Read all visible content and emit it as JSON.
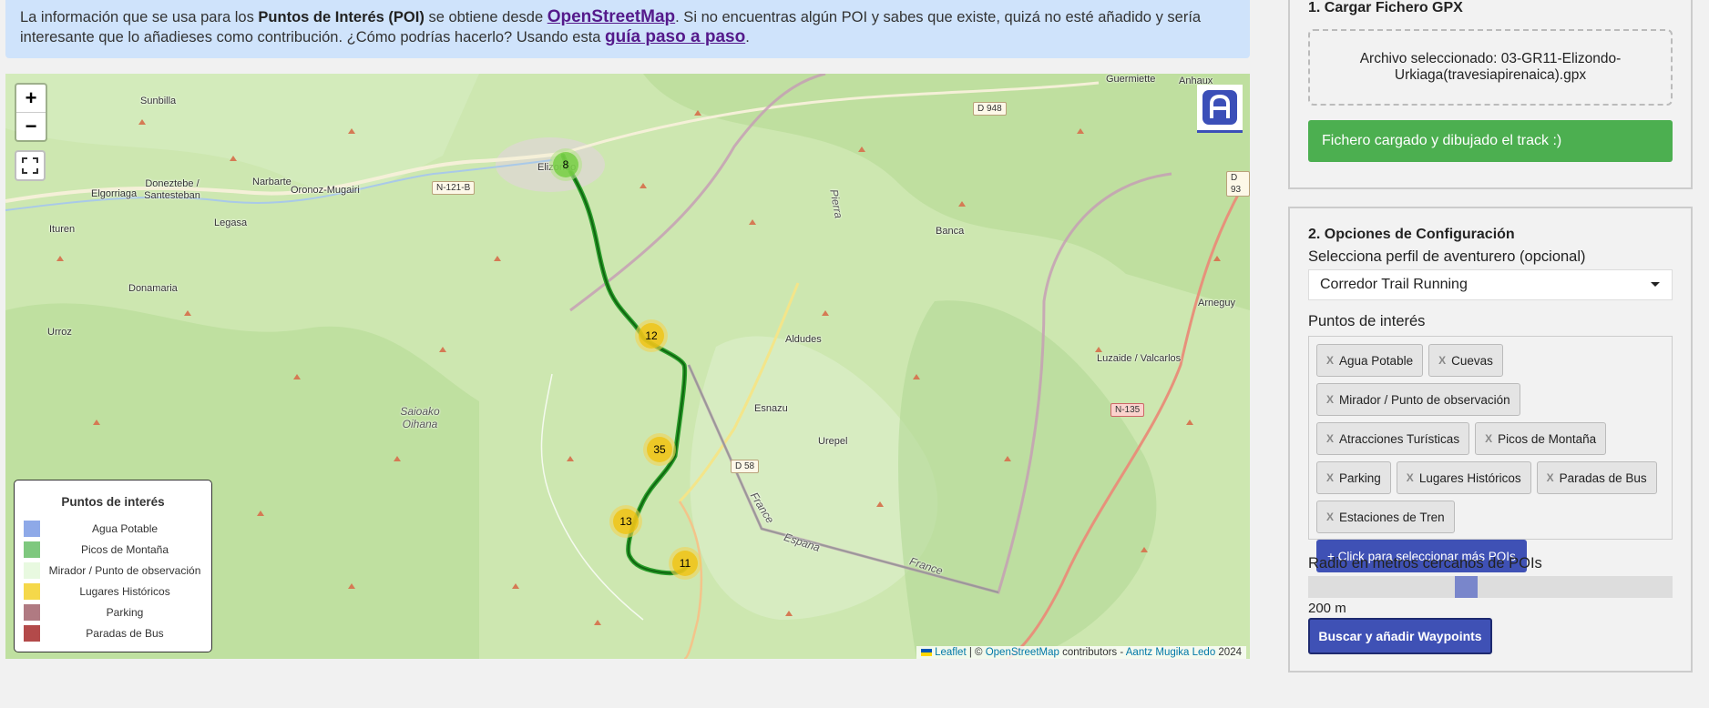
{
  "banner": {
    "t1": "La información que se usa para los ",
    "b1": "Puntos de Interés (POI)",
    "t2": " se obtiene desde ",
    "link1": "OpenStreetMap",
    "t3": ". Si no encuentras algún POI y sabes que existe, quizá no esté añadido y sería interesante que lo añadieses como contribución. ¿Cómo podrías hacerlo? Usando esta ",
    "link2": "guía paso a paso",
    "t4": "."
  },
  "map": {
    "zoom_in": "+",
    "zoom_out": "−",
    "places": [
      "Sunbilla",
      "Elizondo",
      "Oronoz-Mugairi",
      "Elgorriaga",
      "Doneztebe / Santesteban",
      "Narbarte",
      "Legasa",
      "Ituren",
      "Donamaria",
      "Urroz",
      "Saioako Oihana",
      "Banca",
      "Guermiette",
      "Anhaux",
      "Aldudes",
      "Esnazu",
      "Urepel",
      "Arneguy",
      "Luzaide / Valcarlos",
      "Espana",
      "France",
      "France",
      "Pierra"
    ],
    "roads": [
      "N-121-B",
      "D 948",
      "D 93",
      "D 58",
      "N-135"
    ],
    "clusters": [
      {
        "count": "8",
        "color": "green"
      },
      {
        "count": "12",
        "color": "yellow"
      },
      {
        "count": "35",
        "color": "yellow"
      },
      {
        "count": "13",
        "color": "yellow"
      },
      {
        "count": "11",
        "color": "yellow"
      }
    ],
    "legend": {
      "title": "Puntos de interés",
      "items": [
        {
          "label": "Agua Potable",
          "color": "#8ea9e8"
        },
        {
          "label": "Picos de Montaña",
          "color": "#7ec87e"
        },
        {
          "label": "Mirador / Punto de observación",
          "color": "#e8f9e0"
        },
        {
          "label": "Lugares Históricos",
          "color": "#f5d84a"
        },
        {
          "label": "Parking",
          "color": "#b07a82"
        },
        {
          "label": "Paradas de Bus",
          "color": "#b34a4a"
        }
      ]
    },
    "attribution": {
      "leaflet": "Leaflet",
      "sep": " | © ",
      "osm": "OpenStreetMap",
      "contrib": " contributors - ",
      "author": "Aantz Mugika Ledo",
      "year": " 2024"
    }
  },
  "panel1": {
    "title": "1. Cargar Fichero GPX",
    "file_text": "Archivo seleccionado: 03-GR11-Elizondo-Urkiaga(travesiapirenaica).gpx",
    "success": "Fichero cargado y dibujado el track :)"
  },
  "panel2": {
    "title": "2. Opciones de Configuración",
    "profile_label": "Selecciona perfil de aventurero (opcional)",
    "profile_value": "Corredor Trail Running",
    "poi_label": "Puntos de interés",
    "tags": [
      "Agua Potable",
      "Cuevas",
      "Mirador / Punto de observación",
      "Atracciones Turísticas",
      "Picos de Montaña",
      "Parking",
      "Lugares Históricos",
      "Paradas de Bus",
      "Estaciones de Tren"
    ],
    "more_button": "+ Click para seleccionar más POIs",
    "radius_label": "Radio en metros cercanos de POIs",
    "radius_value": "200 m",
    "radius_fraction": 0.43,
    "search_button": "Buscar y añadir Waypoints"
  }
}
